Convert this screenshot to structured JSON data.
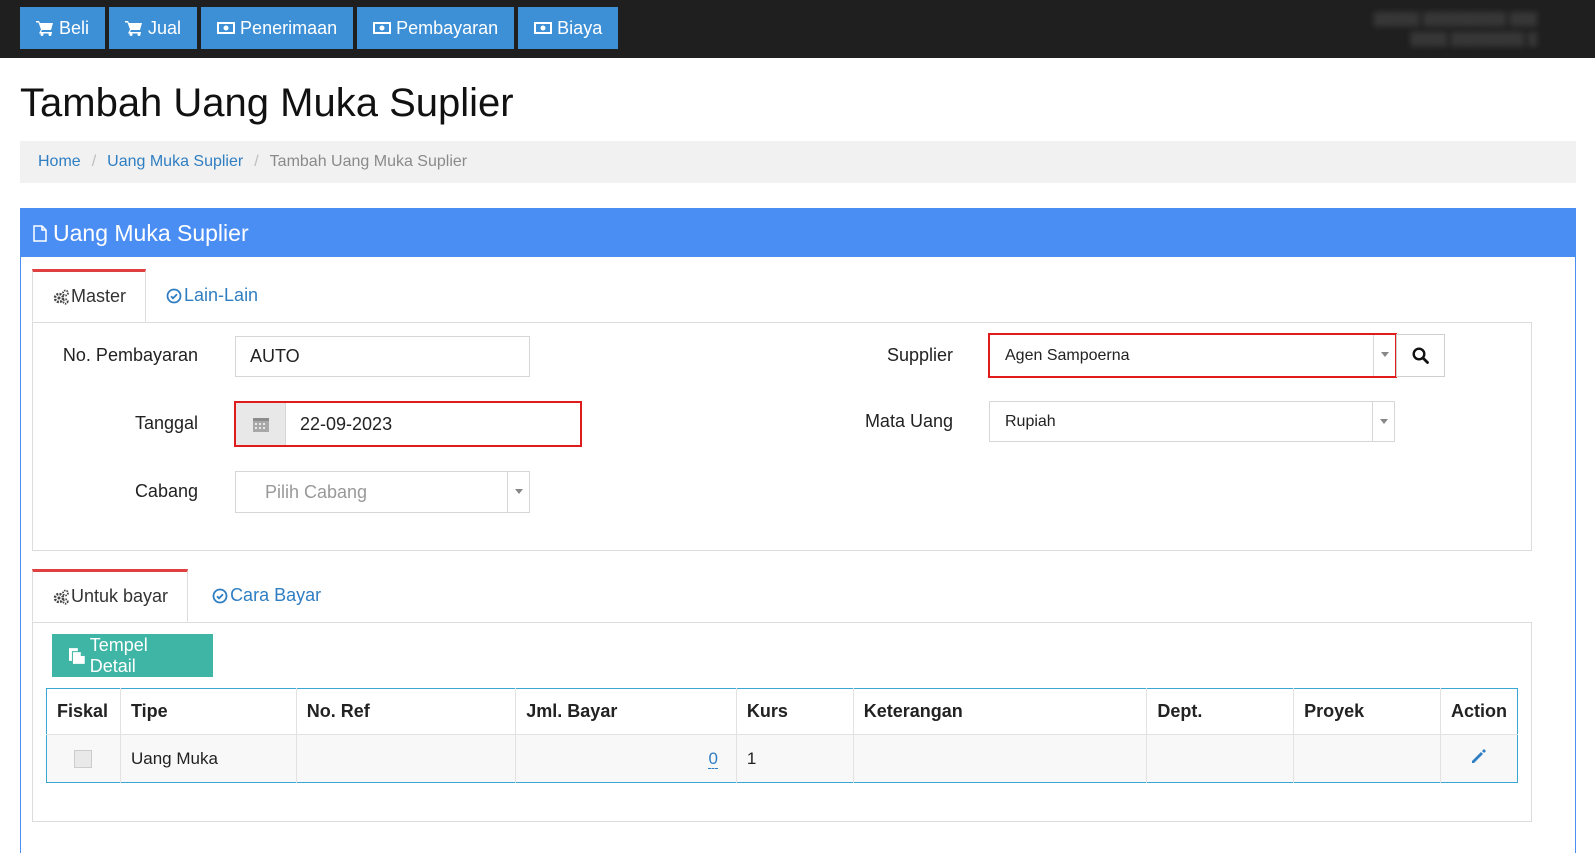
{
  "topnav": {
    "items": [
      {
        "label": "Beli",
        "icon": "cart-icon"
      },
      {
        "label": "Jual",
        "icon": "cart-icon"
      },
      {
        "label": "Penerimaan",
        "icon": "money-icon"
      },
      {
        "label": "Pembayaran",
        "icon": "money-icon"
      },
      {
        "label": "Biaya",
        "icon": "money-icon"
      }
    ]
  },
  "page": {
    "title": "Tambah Uang Muka Suplier"
  },
  "breadcrumb": {
    "home": "Home",
    "parent": "Uang Muka Suplier",
    "current": "Tambah Uang Muka Suplier"
  },
  "panel": {
    "title": "Uang Muka Suplier"
  },
  "tabs_top": {
    "master": "Master",
    "lain": "Lain-Lain"
  },
  "form": {
    "no_pembayaran_label": "No. Pembayaran",
    "no_pembayaran_value": "AUTO",
    "tanggal_label": "Tanggal",
    "tanggal_value": "22-09-2023",
    "cabang_label": "Cabang",
    "cabang_placeholder": "Pilih Cabang",
    "supplier_label": "Supplier",
    "supplier_value": "Agen Sampoerna",
    "mata_uang_label": "Mata Uang",
    "mata_uang_value": "Rupiah"
  },
  "tabs_bottom": {
    "untuk_bayar": "Untuk bayar",
    "cara_bayar": "Cara Bayar"
  },
  "buttons": {
    "tempel_detail": "Tempel Detail"
  },
  "table": {
    "headers": [
      "Fiskal",
      "Tipe",
      "No. Ref",
      "Jml. Bayar",
      "Kurs",
      "Keterangan",
      "Dept.",
      "Proyek",
      "Action"
    ],
    "rows": [
      {
        "fiskal": false,
        "tipe": "Uang Muka",
        "no_ref": "",
        "jml_bayar": "0",
        "kurs": "1",
        "keterangan": "",
        "dept": "",
        "proyek": ""
      }
    ]
  },
  "colors": {
    "topbar": "#1f1f1f",
    "nav_button": "#3d8fd6",
    "panel_header": "#4b8ef3",
    "highlight": "#e01b1b",
    "teal_button": "#3fb5a5"
  }
}
